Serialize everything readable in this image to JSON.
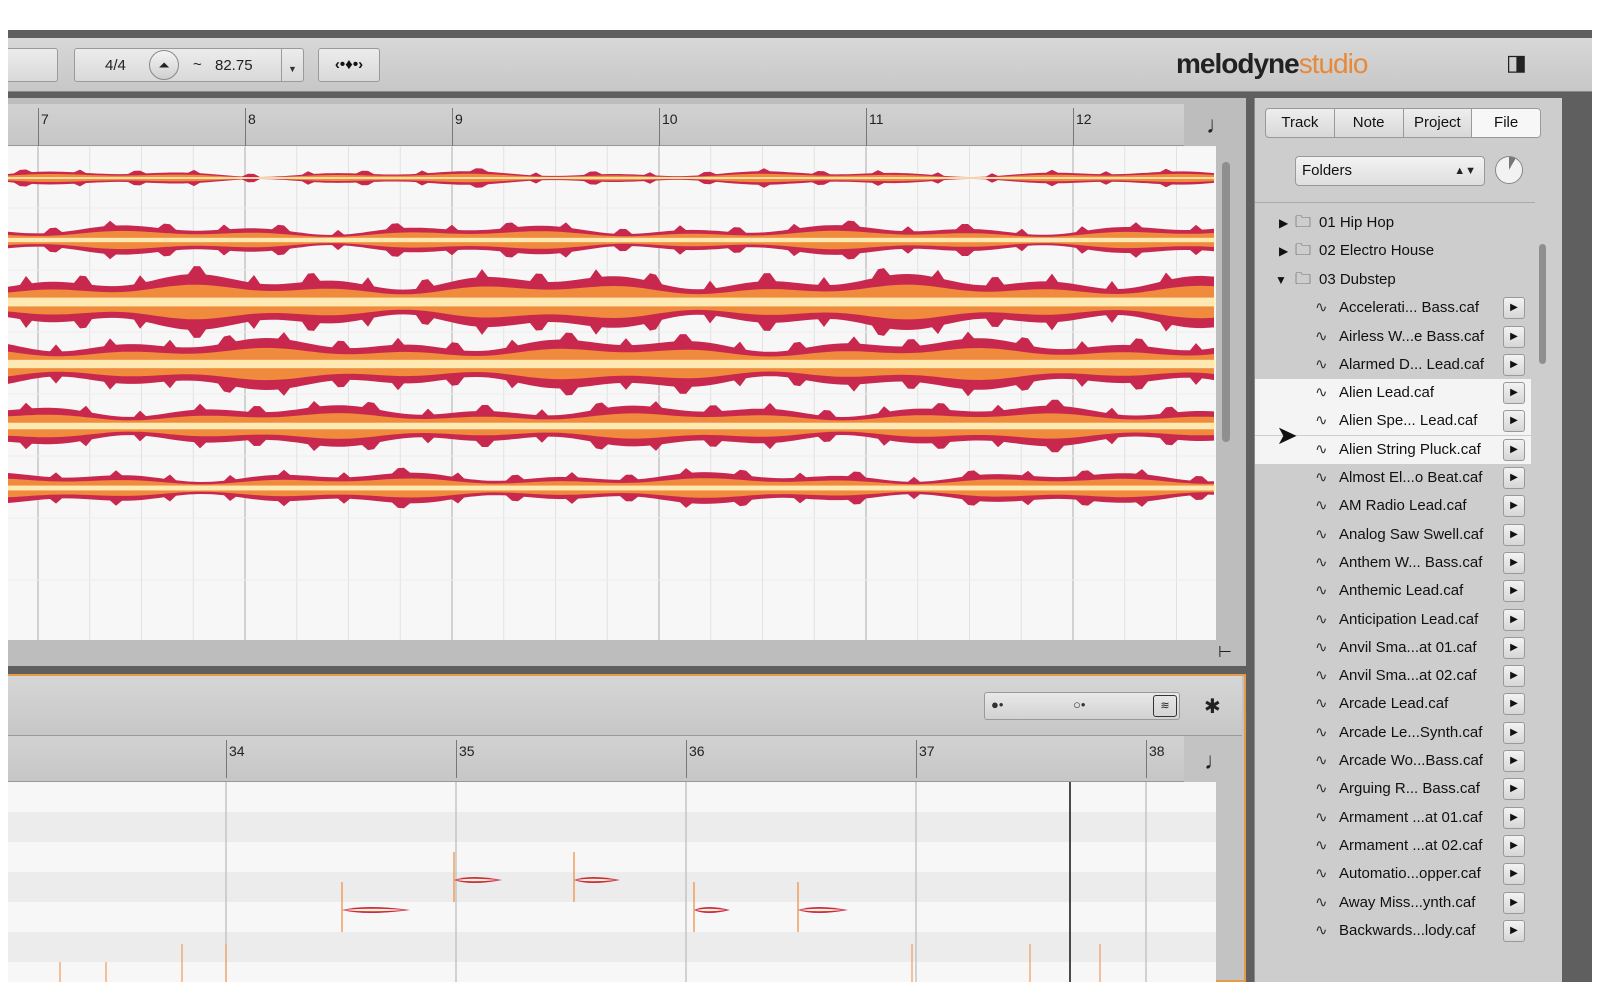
{
  "toolbar": {
    "time_signature": "4/4",
    "metronome_icon": "metronome-icon",
    "tempo_tilde": "~",
    "tempo_value": "82.75",
    "tempo_dropdown_icon": "chevron-down-icon",
    "tool_icon": "note-tool-icon",
    "logo_main": "melodyne",
    "logo_sub": "studio",
    "layout_icon": "panel-layout-icon"
  },
  "upper_editor": {
    "bar_numbers": [
      "7",
      "8",
      "9",
      "10",
      "11",
      "12"
    ],
    "note_symbol": "♩"
  },
  "lower_editor": {
    "bar_numbers": [
      "34",
      "35",
      "36",
      "37",
      "38"
    ],
    "note_symbol": "♩",
    "gear_icon": "gear-icon"
  },
  "side_panel": {
    "tabs": [
      {
        "label": "Track",
        "active": false
      },
      {
        "label": "Note",
        "active": false
      },
      {
        "label": "Project",
        "active": false
      },
      {
        "label": "File",
        "active": true
      }
    ],
    "folder_select": "Folders",
    "folders": [
      {
        "label": "01 Hip Hop",
        "expanded": false
      },
      {
        "label": "02 Electro House",
        "expanded": false
      },
      {
        "label": "03 Dubstep",
        "expanded": true
      }
    ],
    "files": [
      {
        "label": "Accelerati... Bass.caf",
        "selected": false
      },
      {
        "label": "Airless W...e Bass.caf",
        "selected": false
      },
      {
        "label": "Alarmed D... Lead.caf",
        "selected": false
      },
      {
        "label": "Alien Lead.caf",
        "selected": true
      },
      {
        "label": "Alien Spe... Lead.caf",
        "selected": true
      },
      {
        "label": "Alien String Pluck.caf",
        "selected": true
      },
      {
        "label": "Almost El...o Beat.caf",
        "selected": false
      },
      {
        "label": "AM Radio Lead.caf",
        "selected": false
      },
      {
        "label": "Analog Saw Swell.caf",
        "selected": false
      },
      {
        "label": "Anthem W... Bass.caf",
        "selected": false
      },
      {
        "label": "Anthemic Lead.caf",
        "selected": false
      },
      {
        "label": "Anticipation Lead.caf",
        "selected": false
      },
      {
        "label": "Anvil Sma...at 01.caf",
        "selected": false
      },
      {
        "label": "Anvil Sma...at 02.caf",
        "selected": false
      },
      {
        "label": "Arcade Lead.caf",
        "selected": false
      },
      {
        "label": "Arcade Le...Synth.caf",
        "selected": false
      },
      {
        "label": "Arcade Wo...Bass.caf",
        "selected": false
      },
      {
        "label": "Arguing R... Bass.caf",
        "selected": false
      },
      {
        "label": "Armament ...at 01.caf",
        "selected": false
      },
      {
        "label": "Armament ...at 02.caf",
        "selected": false
      },
      {
        "label": "Automatio...opper.caf",
        "selected": false
      },
      {
        "label": "Away Miss...ynth.caf",
        "selected": false
      },
      {
        "label": "Backwards...lody.caf",
        "selected": false
      }
    ]
  },
  "colors": {
    "blob_outer": "#c8284e",
    "blob_mid": "#f08a3c",
    "blob_inner": "#fff3c0",
    "accent": "#e8893a"
  }
}
